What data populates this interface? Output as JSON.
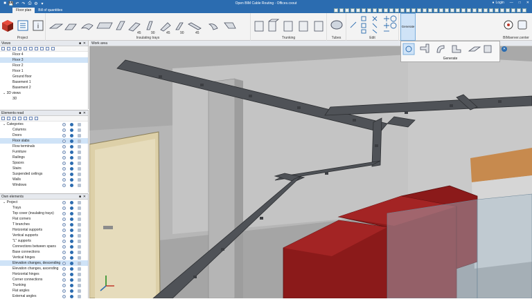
{
  "app": {
    "title": "Open BIM Cable Routing - Offices.cxout",
    "login_label": "Login"
  },
  "menu": {
    "tabs": [
      "Floor plan",
      "Bill of quantities"
    ]
  },
  "ribbon": {
    "groups": {
      "project": "Project",
      "insulating_trays": "Insulating trays",
      "trunking": "Trunking",
      "tubes": "Tubes",
      "edit": "Edit",
      "generate_btn": "Generate",
      "bimserver": "BIMserver.center"
    },
    "tool_numbers": [
      "45",
      "90",
      "45",
      "90",
      "45"
    ]
  },
  "generate_panel": {
    "label": "Generate"
  },
  "views": {
    "title": "Views",
    "items": [
      "Floor 4",
      "Floor 3",
      "Floor 2",
      "Floor 1",
      "Ground floor",
      "Basement 1",
      "Basement 2"
    ],
    "views3d_label": "3D views",
    "views3d_items": [
      "3D"
    ],
    "selected": "Floor 3"
  },
  "elements_read": {
    "title": "Elements read",
    "root": "Categories",
    "items": [
      "Columns",
      "Doors",
      "Floor slabs",
      "Flow terminals",
      "Furniture",
      "Railings",
      "Spaces",
      "Stairs",
      "Suspended ceilings",
      "Walls",
      "Windows"
    ],
    "selected": "Floor slabs"
  },
  "own_elements": {
    "title": "Own elements",
    "root": "Project",
    "items": [
      "Trays",
      "Top cover (insulating trays)",
      "Flat corners",
      "T branches",
      "Horizontal supports",
      "Vertical supports",
      "\"L\" supports",
      "Connections between spans",
      "Base connections",
      "Vertical hinges",
      "Elevation changes, descending",
      "Elevation changes, ascending",
      "Horizontal hinges",
      "Corner connections",
      "Trunking",
      "Flat angles",
      "External angles"
    ],
    "selected": "Elevation changes, descending"
  },
  "workarea": {
    "title": "Work area"
  },
  "colors": {
    "accent": "#2b6cb0",
    "tray": "#4a4d52",
    "machine": "#8b1a1a"
  }
}
